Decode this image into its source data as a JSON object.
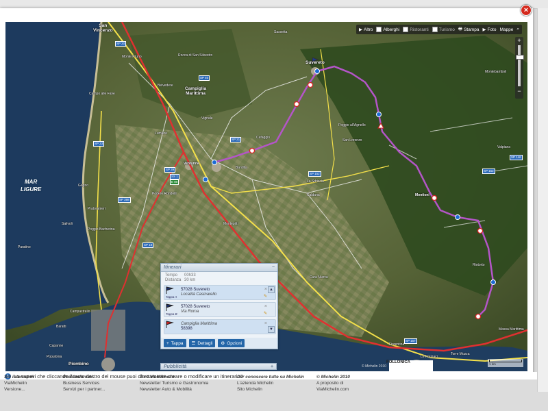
{
  "close_label": "×",
  "toolbar": {
    "items": [
      {
        "label": "Altro",
        "icon": "play-icon"
      },
      {
        "label": "Alberghi",
        "icon": "checkbox"
      },
      {
        "label": "Ristoranti",
        "icon": "checkbox"
      },
      {
        "label": "Turismo",
        "icon": "checkbox"
      },
      {
        "label": "Stampa",
        "icon": "printer-icon"
      },
      {
        "label": "Foto",
        "icon": "play-icon"
      },
      {
        "label": "Mappe",
        "icon": ""
      }
    ],
    "search_icon": "search-icon"
  },
  "zoom": {
    "in": "+",
    "out": "−"
  },
  "map": {
    "sea_label_1": "MAR",
    "sea_label_2": "LIGURE",
    "towns": {
      "san_vincenzo": "San\nVincenzo",
      "suvereto": "Suvereto",
      "campiglia": "Campiglia\nMarittima",
      "piombino": "Piombino",
      "follonica": "FOLLONICA",
      "venturina": "Venturina",
      "montioni": "Montioni"
    },
    "places": [
      "Monte Pruno",
      "Montebamboli",
      "Sassetta",
      "Rocca di San Silvestro",
      "Belvedere",
      "Campo alle Fave",
      "Lumiere",
      "Poggio all'Agnello",
      "Riotorto",
      "Vignale",
      "Gagno",
      "Poggio Bacherina",
      "Campastrello",
      "La Sdriscia",
      "Caldana",
      "Cafaggio",
      "Bandita",
      "San Lorenzo",
      "Podere Rondelli",
      "Salivoli",
      "Pratoranieri",
      "Cura Nuova",
      "Valpiana",
      "Massa Marittima",
      "Capanne",
      "Paratino",
      "Populonia",
      "Baratti",
      "Fiorentina",
      "Torre Mozza",
      "Montepitti",
      "Le Forniaci"
    ],
    "road_shields": [
      "SP 20",
      "SP 23",
      "SP 39",
      "SS 1",
      "E 80",
      "SP 40",
      "SP 398",
      "SP 18",
      "SP 152",
      "SS 439",
      "SP 152",
      "SP 146",
      "SP 21",
      "SP 157"
    ],
    "scale_label": "1 km",
    "copyright": "© Michelin 2010"
  },
  "itinerary": {
    "title": "Itinerari",
    "tempo_label": "Tempo",
    "tempo_value": "00h33",
    "distanza_label": "Distanza",
    "distanza_value": "30 km",
    "stops": [
      {
        "tag": "Tappa A",
        "line1": "57028 Suvereto",
        "line2": "Località Casinarello"
      },
      {
        "tag": "Tappa B",
        "line1": "57028 Suvereto",
        "line2": "Via Roma"
      },
      {
        "tag": "",
        "line1": "Campiglia Marittima",
        "line2": "58398"
      }
    ],
    "buttons": {
      "tappa": "Tappa",
      "dettagli": "Dettagli",
      "opzioni": "Opzioni"
    },
    "collapse": "−"
  },
  "pubblicita": {
    "title": "Pubblicità",
    "expand": "+"
  },
  "tip": "Lo sapevi che cliccando il tasto destro del mouse puoi direttamente creare o modificare un itinerario?",
  "footer": {
    "col1": [
      "Siti internet di",
      "ViaMichelin",
      "Versione..."
    ],
    "col2": [
      "Professionisti",
      "Business Services",
      "Servizi per i partner..."
    ],
    "col3": [
      "Tu e ViaMichelin",
      "Newsletter Turismo e Gastronomia",
      "Newsletter Auto & Mobilità"
    ],
    "col4": [
      "Per conoscere tutte su Michelin",
      "L'azienda Michelin",
      "Sito Michelin"
    ],
    "col5": [
      "© Michelin 2010",
      "A proposito di",
      "ViaMichelin.com"
    ]
  }
}
